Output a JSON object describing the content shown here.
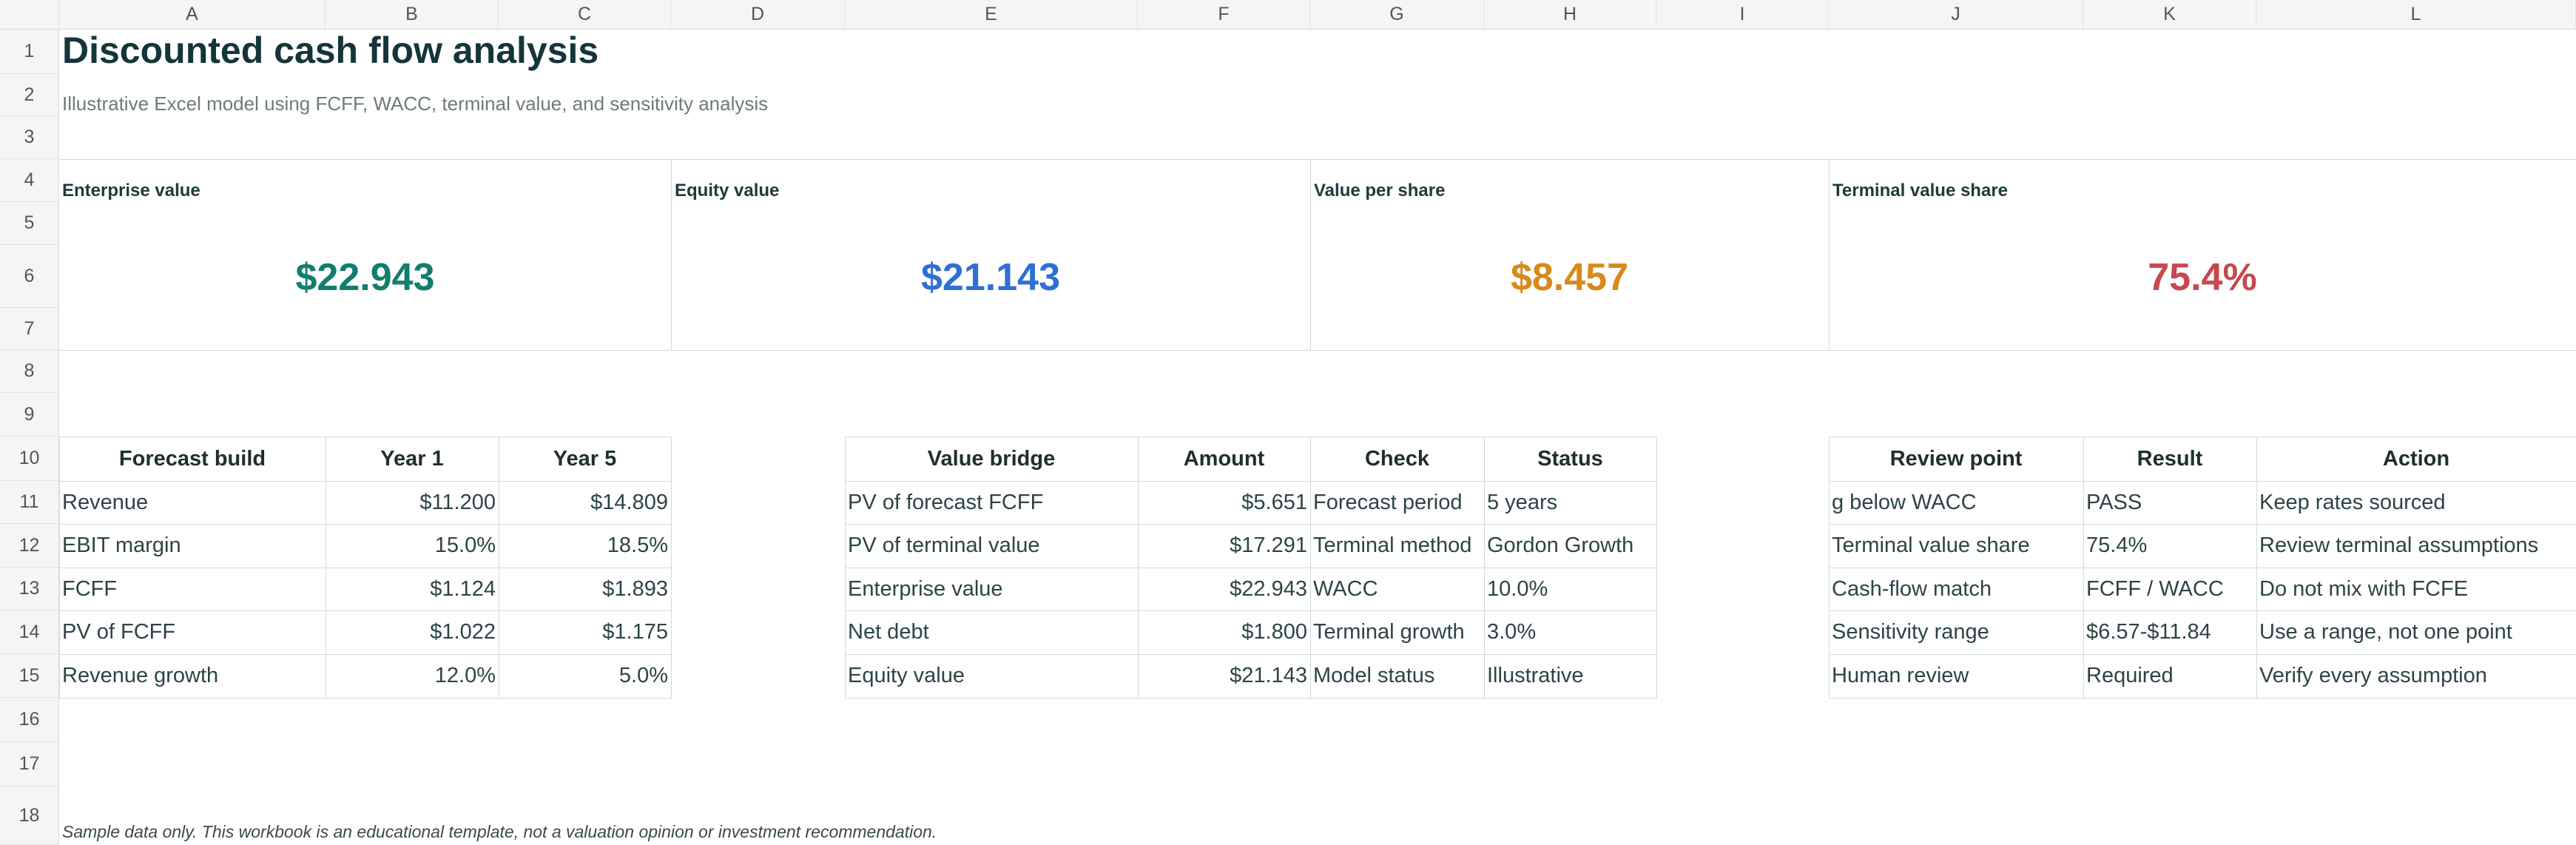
{
  "columns": [
    "A",
    "B",
    "C",
    "D",
    "E",
    "F",
    "G",
    "H",
    "I",
    "J",
    "K",
    "L"
  ],
  "rows": [
    "1",
    "2",
    "3",
    "4",
    "5",
    "6",
    "7",
    "8",
    "9",
    "10",
    "11",
    "12",
    "13",
    "14",
    "15",
    "16",
    "17",
    "18"
  ],
  "title": "Discounted cash flow analysis",
  "subtitle": "Illustrative Excel model using FCFF, WACC, terminal value, and sensitivity analysis",
  "kpis": [
    {
      "label": "Enterprise value",
      "value": "$22.943",
      "color": "#137d6e"
    },
    {
      "label": "Equity value",
      "value": "$21.143",
      "color": "#2f6fd6"
    },
    {
      "label": "Value per share",
      "value": "$8.457",
      "color": "#d9891a"
    },
    {
      "label": "Terminal value share",
      "value": "75.4%",
      "color": "#c7484f"
    }
  ],
  "forecast": {
    "headers": [
      "Forecast build",
      "Year 1",
      "Year 5"
    ],
    "rows": [
      [
        "Revenue",
        "$11.200",
        "$14.809"
      ],
      [
        "EBIT margin",
        "15.0%",
        "18.5%"
      ],
      [
        "FCFF",
        "$1.124",
        "$1.893"
      ],
      [
        "PV of FCFF",
        "$1.022",
        "$1.175"
      ],
      [
        "Revenue growth",
        "12.0%",
        "5.0%"
      ]
    ]
  },
  "bridge": {
    "headers": [
      "Value bridge",
      "Amount",
      "Check",
      "Status"
    ],
    "rows": [
      [
        "PV of forecast FCFF",
        "$5.651",
        "Forecast period",
        "5 years"
      ],
      [
        "PV of terminal value",
        "$17.291",
        "Terminal method",
        "Gordon Growth"
      ],
      [
        "Enterprise value",
        "$22.943",
        "WACC",
        "10.0%"
      ],
      [
        "Net debt",
        "$1.800",
        "Terminal growth",
        "3.0%"
      ],
      [
        "Equity value",
        "$21.143",
        "Model status",
        "Illustrative"
      ]
    ]
  },
  "review": {
    "headers": [
      "Review point",
      "Result",
      "Action"
    ],
    "rows": [
      [
        "g below WACC",
        "PASS",
        "Keep rates sourced"
      ],
      [
        "Terminal value share",
        "75.4%",
        "Review terminal assumptions"
      ],
      [
        "Cash-flow match",
        "FCFF / WACC",
        "Do not mix with FCFE"
      ],
      [
        "Sensitivity range",
        "$6.57-$11.84",
        "Use a range, not one point"
      ],
      [
        "Human review",
        "Required",
        "Verify every assumption"
      ]
    ]
  },
  "footnote": "Sample data only. This workbook is an educational template, not a valuation opinion or investment recommendation."
}
